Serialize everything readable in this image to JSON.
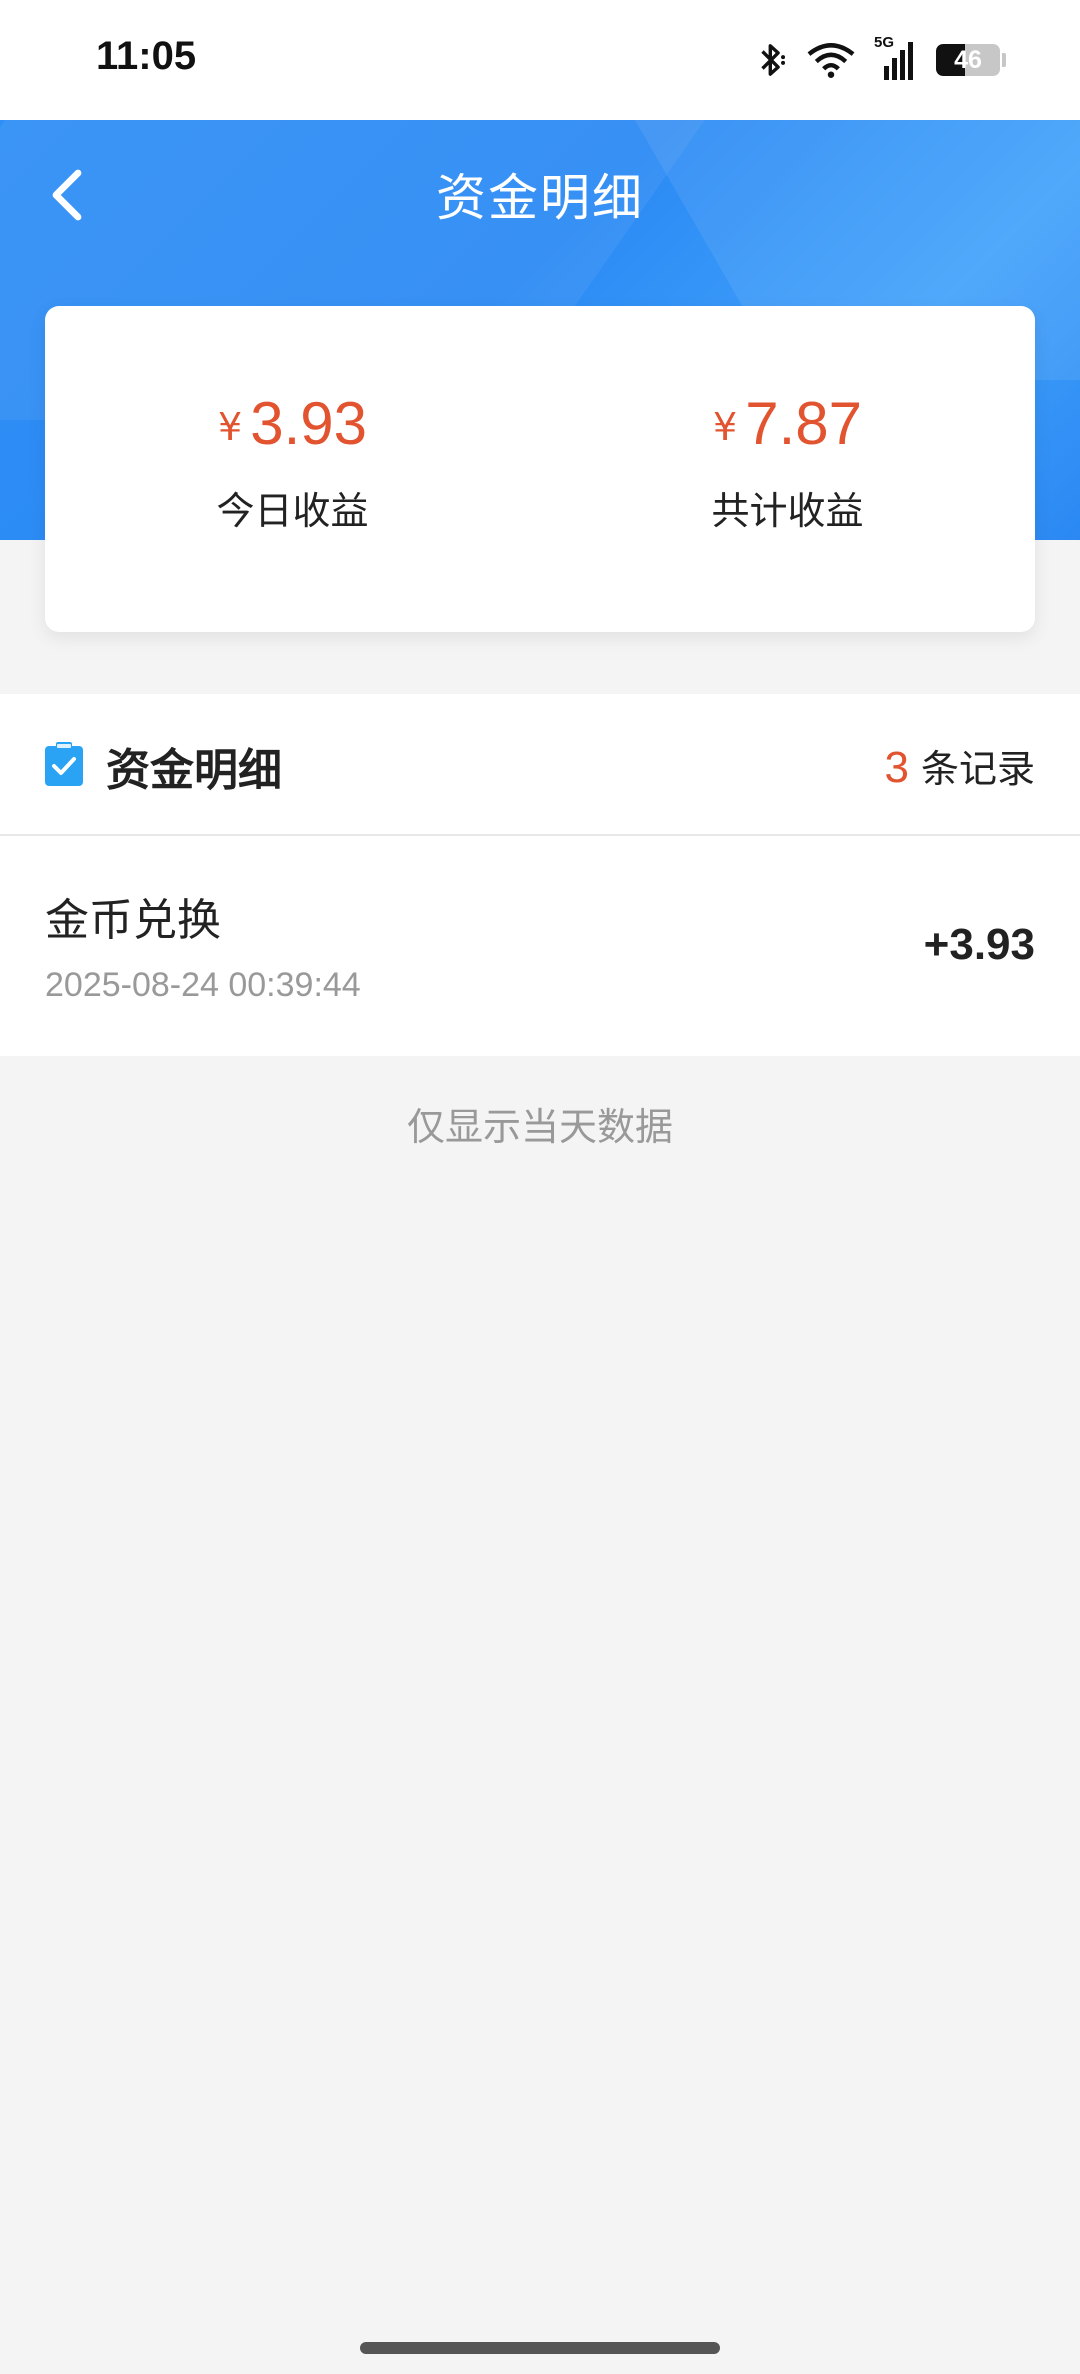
{
  "status_bar": {
    "time": "11:05",
    "network": "5G",
    "battery": 46,
    "battery_text": "46"
  },
  "header": {
    "title": "资金明细",
    "back_icon": "chevron-left-icon"
  },
  "summary": {
    "currency_symbol": "¥",
    "today_amount": "3.93",
    "today_label": "今日收益",
    "total_amount": "7.87",
    "total_label": "共计收益"
  },
  "section": {
    "icon": "clipboard-check-icon",
    "title": "资金明细",
    "record_count": "3",
    "record_suffix": "条记录"
  },
  "records": [
    {
      "title": "金币兑换",
      "time": "2025-08-24 00:39:44",
      "amount": "+3.93"
    }
  ],
  "footer_note": "仅显示当天数据",
  "colors": {
    "accent_blue": "#2f8ff6",
    "amount_red": "#e2532f",
    "icon_blue": "#2aa3f5"
  }
}
